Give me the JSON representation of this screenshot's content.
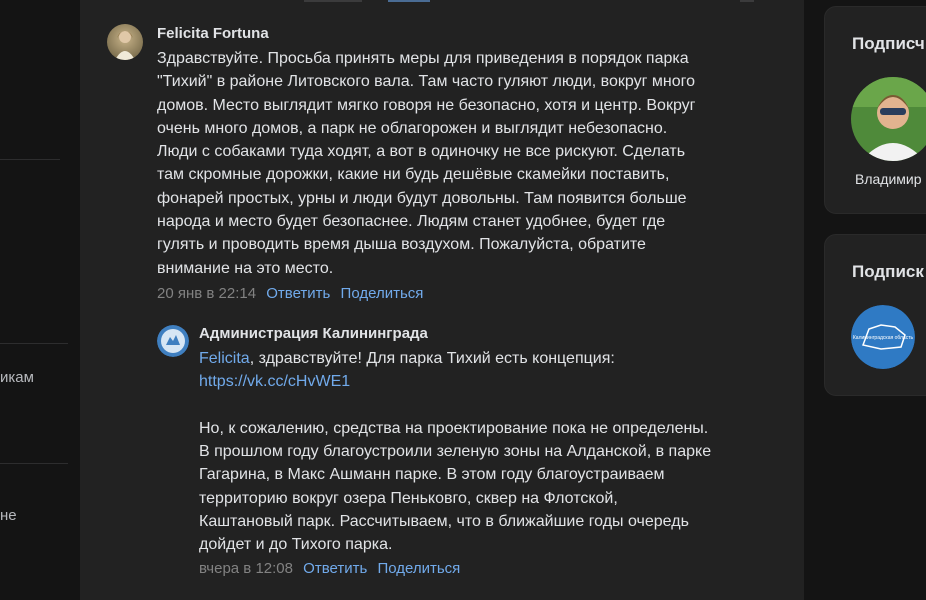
{
  "left_nav": {
    "frag_1": "икам",
    "frag_2": "не"
  },
  "comment": {
    "author": "Felicita Fortuna",
    "lines": [
      "Здравствуйте. Просьба принять меры для приведения в порядок парка",
      "\"Тихий\" в районе Литовского вала. Там часто гуляют люди, вокруг много",
      "домов. Место выглядит мягко говоря не безопасно, хотя и центр. Вокруг",
      "очень много домов, а парк не облагорожен и выглядит небезопасно.",
      "Люди с собаками туда ходят, а вот в одиночку не все рискуют. Сделать",
      "там скромные дорожки, какие ни будь дешёвые скамейки поставить,",
      "фонарей простых, урны и люди будут довольны. Там появится больше",
      "народа и место будет безопаснее. Людям станет удобнее, будет где",
      "гулять и проводить время дыша воздухом. Пожалуйста, обратите",
      "внимание на это место."
    ],
    "time": "20 янв в 22:14",
    "reply_label": "Ответить",
    "share_label": "Поделиться"
  },
  "reply": {
    "author": "Администрация Калининграда",
    "mention": "Felicita",
    "first_line_rest": ", здравствуйте! Для парка Тихий есть концепция:",
    "url": "https://vk.cc/cHvWE1",
    "lines": [
      "Но, к сожалению, средства на проектирование пока не определены.",
      "В прошлом году благоустроили зеленую зоны на Алданской, в парке",
      "Гагарина, в Макс Ашманн парке. В этом году благоустраиваем",
      "территорию вокруг озера Пеньковго, сквер на Флотской,",
      "Каштановый парк. Рассчитываем, что в ближайшие годы очередь",
      "дойдет и до Тихого парка."
    ],
    "time": "вчера в 12:08",
    "reply_label": "Ответить",
    "share_label": "Поделиться",
    "badge_text": "Калининградская область"
  },
  "sidebar": {
    "card1_title": "Подписч",
    "card1_name": "Владимир",
    "card2_title": "Подписк",
    "card2_badge_text": "Калининградская область"
  },
  "colors": {
    "background": "#141414",
    "panel": "#222222",
    "link": "#71aaeb",
    "muted": "#828282",
    "text": "#e1e3e6"
  }
}
